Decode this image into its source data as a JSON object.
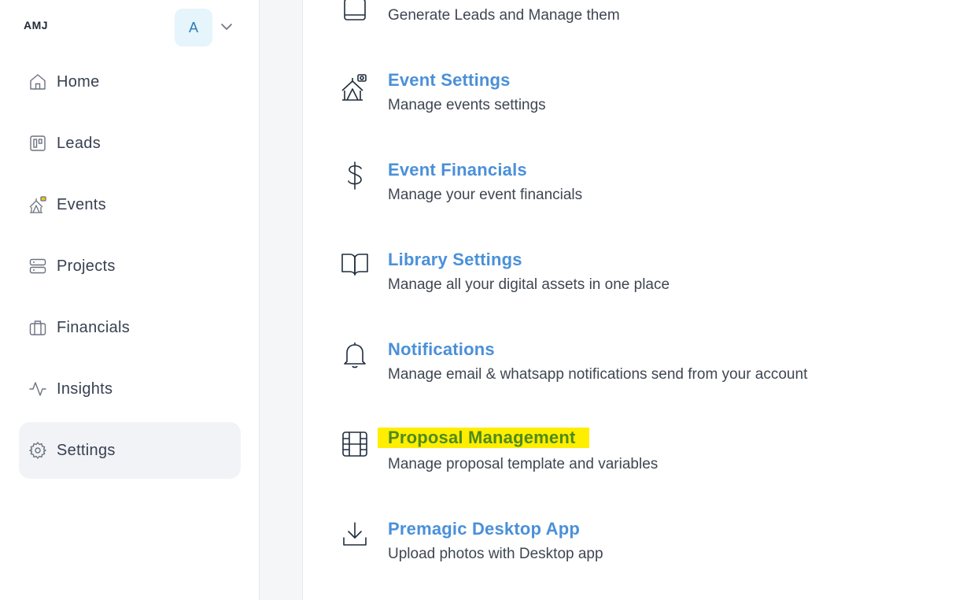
{
  "sidebar": {
    "brand": "AMJ",
    "avatar_letter": "A",
    "items": [
      {
        "label": "Home",
        "icon": "home-icon"
      },
      {
        "label": "Leads",
        "icon": "kanban-icon"
      },
      {
        "label": "Events",
        "icon": "tent-icon"
      },
      {
        "label": "Projects",
        "icon": "server-icon"
      },
      {
        "label": "Financials",
        "icon": "briefcase-icon"
      },
      {
        "label": "Insights",
        "icon": "activity-icon"
      },
      {
        "label": "Settings",
        "icon": "gear-icon",
        "active": true
      }
    ]
  },
  "settings_list": [
    {
      "title": "",
      "desc": "Generate Leads and Manage them",
      "icon": "calendar-icon"
    },
    {
      "title": "Event Settings",
      "desc": "Manage events settings",
      "icon": "tent-icon"
    },
    {
      "title": "Event Financials",
      "desc": "Manage your event financials",
      "icon": "dollar-icon"
    },
    {
      "title": "Library Settings",
      "desc": "Manage all your digital assets in one place",
      "icon": "book-icon"
    },
    {
      "title": "Notifications",
      "desc": "Manage email & whatsapp notifications send from your account",
      "icon": "bell-icon"
    },
    {
      "title": "Proposal Management",
      "desc": "Manage proposal template and variables",
      "icon": "film-icon",
      "highlighted": true
    },
    {
      "title": "Premagic Desktop App",
      "desc": "Upload photos with Desktop app",
      "icon": "download-icon"
    }
  ],
  "colors": {
    "title_blue": "#4a90d9",
    "highlight_yellow": "#ffee00",
    "highlight_text": "#4f8a1e",
    "active_bg": "#f1f3f6"
  }
}
